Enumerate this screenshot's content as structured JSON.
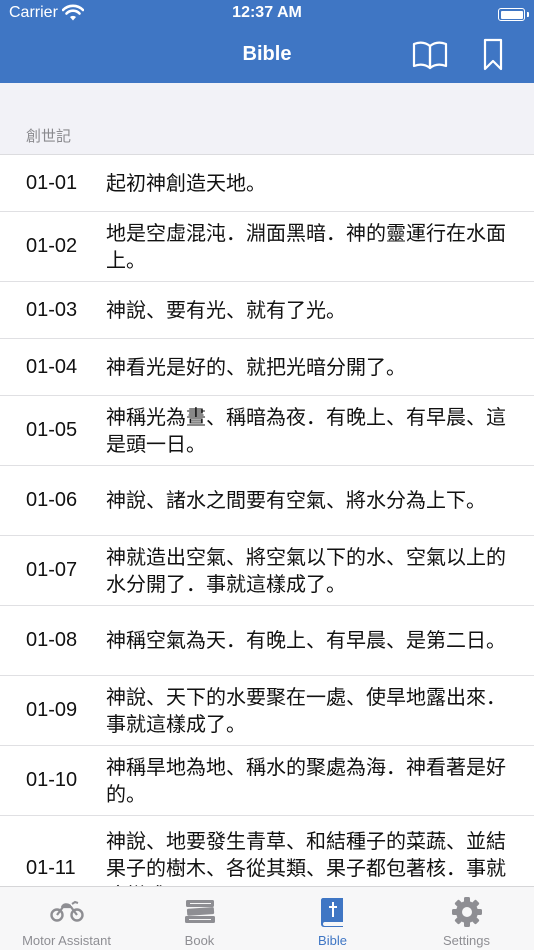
{
  "status": {
    "carrier": "Carrier",
    "time": "12:37 AM"
  },
  "header": {
    "title": "Bible",
    "book_icon": "book-open-icon",
    "bookmark_icon": "bookmark-icon"
  },
  "section": {
    "title": "創世記"
  },
  "verses": [
    {
      "ref": "01-01",
      "text": "起初神創造天地。"
    },
    {
      "ref": "01-02",
      "text": "地是空虛混沌．淵面黑暗．神的靈運行在水面上。"
    },
    {
      "ref": "01-03",
      "text": "神說、要有光、就有了光。"
    },
    {
      "ref": "01-04",
      "text": "神看光是好的、就把光暗分開了。"
    },
    {
      "ref": "01-05",
      "text": "神稱光為晝、稱暗為夜．有晚上、有早晨、這是頭一日。"
    },
    {
      "ref": "01-06",
      "text": "神說、諸水之間要有空氣、將水分為上下。"
    },
    {
      "ref": "01-07",
      "text": "神就造出空氣、將空氣以下的水、空氣以上的水分開了．事就這樣成了。"
    },
    {
      "ref": "01-08",
      "text": "神稱空氣為天．有晚上、有早晨、是第二日。"
    },
    {
      "ref": "01-09",
      "text": "神說、天下的水要聚在一處、使旱地露出來．事就這樣成了。"
    },
    {
      "ref": "01-10",
      "text": "神稱旱地為地、稱水的聚處為海．神看著是好的。"
    },
    {
      "ref": "01-11",
      "text": "神說、地要發生青草、和結種子的菜蔬、並結果子的樹木、各從其類、果子都包著核．事就這樣成了。"
    }
  ],
  "tabs": [
    {
      "label": "Motor Assistant",
      "icon": "motorcycle-icon",
      "active": false
    },
    {
      "label": "Book",
      "icon": "books-icon",
      "active": false
    },
    {
      "label": "Bible",
      "icon": "bible-icon",
      "active": true
    },
    {
      "label": "Settings",
      "icon": "gear-icon",
      "active": false
    }
  ],
  "colors": {
    "accent": "#3f76c4",
    "inactive": "#8e8e93"
  }
}
